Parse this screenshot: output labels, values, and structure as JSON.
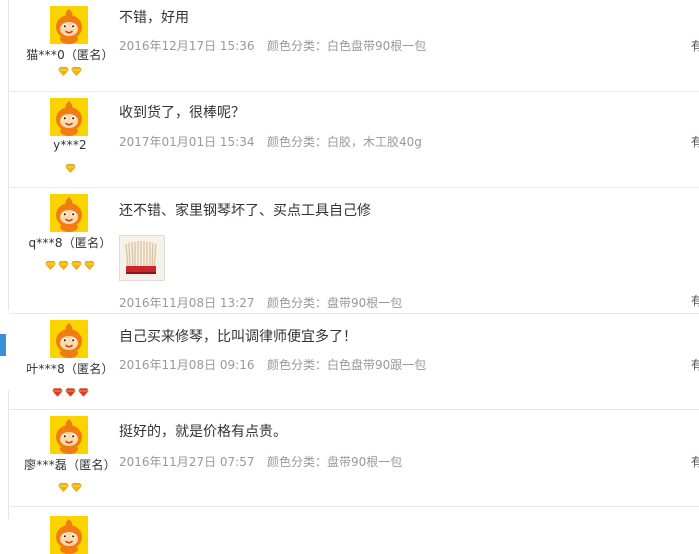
{
  "reviews": [
    {
      "nick": "猫***0（匿名）",
      "text": "不错，好用",
      "date": "2016年12月17日 15:36",
      "sku": "颜色分类：白色盘带90根一包",
      "edge": "有",
      "gems": 2,
      "gem_color": "#f5b800",
      "photos": []
    },
    {
      "nick": "y***2",
      "text": "收到货了，很棒呢？",
      "date": "2017年01月01日 15:34",
      "sku": "颜色分类：白胶，木工胶40g",
      "edge": "有",
      "gems": 1,
      "gem_color": "#f5b800",
      "photos": []
    },
    {
      "nick": "q***8（匿名）",
      "text": "还不错、家里钢琴坏了、买点工具自己修",
      "date": "2016年11月08日 13:27",
      "sku": "颜色分类：盘带90根一包",
      "edge": "有",
      "gems": 4,
      "gem_color": "#f5b800",
      "photos": [
        "piano-felt-strips"
      ]
    },
    {
      "nick": "叶***8（匿名）",
      "text": "自己买来修琴，比叫调律师便宜多了！",
      "date": "2016年11月08日 09:16",
      "sku": "颜色分类：白色盘带90跟一包",
      "edge": "有",
      "gems": 3,
      "gem_color": "#e8332d",
      "photos": []
    },
    {
      "nick": "廖***磊（匿名）",
      "text": "挺好的，就是价格有点贵。",
      "date": "2016年11月27日 07:57",
      "sku": "颜色分类：盘带90根一包",
      "edge": "有",
      "gems": 2,
      "gem_color": "#f5b800",
      "photos": []
    }
  ],
  "colors": {
    "avatar_bg": "#fbd400",
    "mascot_orange": "#f07c12",
    "meta_gray": "#999999",
    "divider": "#e8e8e8",
    "accent_tab": "#3b8fd6"
  }
}
